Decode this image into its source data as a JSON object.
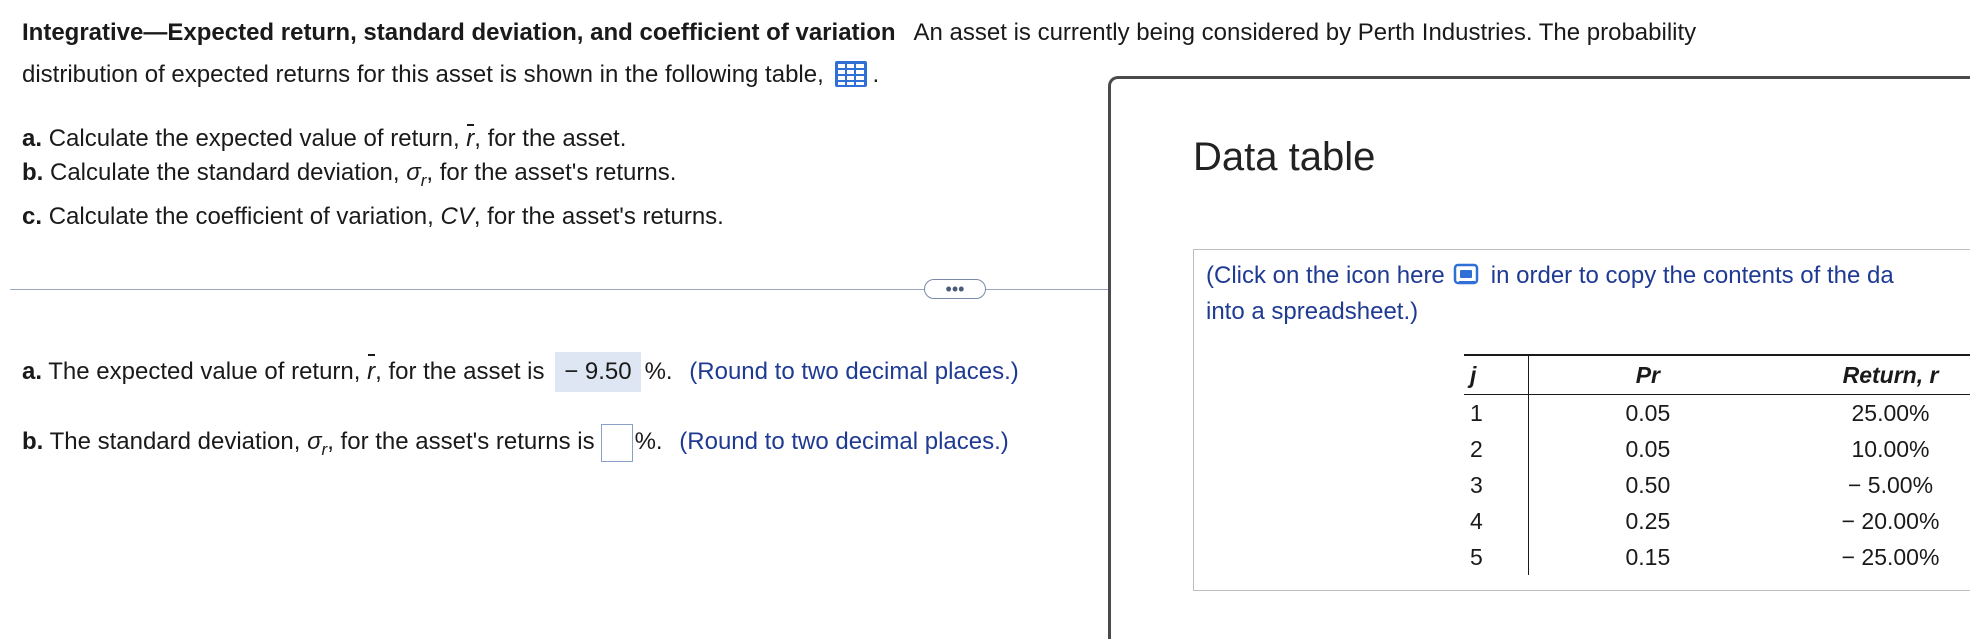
{
  "problem": {
    "title": "Integrative—Expected return, standard deviation, and coefficient of variation",
    "text_line1": "An asset is currently being considered by Perth Industries. The probability",
    "text_line2": "distribution of expected returns for this asset is shown in the following table,",
    "after_icon": ".",
    "table_icon": "table-grid-icon"
  },
  "parts": {
    "a_label": "a.",
    "a_text": "Calculate the expected value of return,",
    "a_var": "r",
    "a_end": ", for the asset.",
    "b_label": "b.",
    "b_text": "Calculate the standard deviation,",
    "b_sym": "σ",
    "b_sub": "r",
    "b_end": ", for the asset's returns.",
    "c_label": "c.",
    "c_text": "Calculate the coefficient of variation,",
    "c_var": "CV",
    "c_end": ", for the asset's returns."
  },
  "more_button": "•••",
  "answers": {
    "a_label": "a.",
    "a_text": "The expected value of return,",
    "a_var": "r",
    "a_mid": ", for the asset is",
    "a_value": "− 9.50",
    "a_unit": "%.",
    "a_hint": "(Round to two decimal places.)",
    "b_label": "b.",
    "b_text": "The standard deviation,",
    "b_sym": "σ",
    "b_sub": "r",
    "b_mid": ", for the asset's returns is",
    "b_value": "",
    "b_unit": "%.",
    "b_hint": "(Round to two decimal places.)"
  },
  "data_table": {
    "title": "Data table",
    "note_before": "(Click on the icon here",
    "note_after": "in order to copy the contents of the da",
    "note_line2": "into a spreadsheet.)",
    "copy_icon": "copy-to-spreadsheet-icon",
    "headers": [
      "j",
      "Pr",
      "Return, r"
    ],
    "rows": [
      {
        "j": "1",
        "pr": "0.05",
        "ret": "25.00%"
      },
      {
        "j": "2",
        "pr": "0.05",
        "ret": "10.00%"
      },
      {
        "j": "3",
        "pr": "0.50",
        "ret": "− 5.00%"
      },
      {
        "j": "4",
        "pr": "0.25",
        "ret": "− 20.00%"
      },
      {
        "j": "5",
        "pr": "0.15",
        "ret": "− 25.00%"
      }
    ]
  },
  "colors": {
    "accent_blue": "#1f3a93",
    "answer_highlight": "#dde6f2",
    "icon_blue": "#2f6fd6"
  }
}
